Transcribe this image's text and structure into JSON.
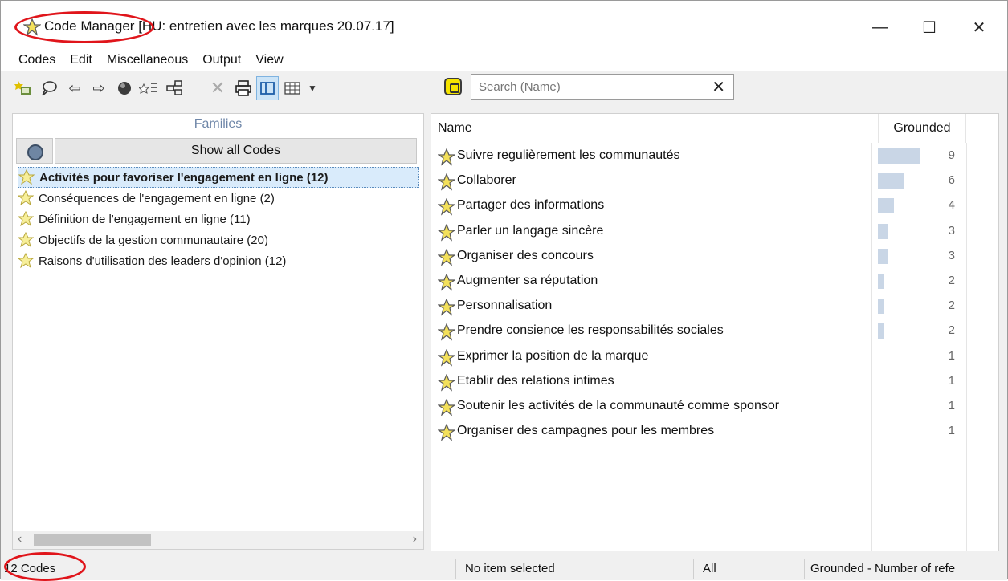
{
  "window": {
    "app_title": "Code Manager",
    "doc_title": "[HU: entretien avec les marques 20.07.17]",
    "minimize": "—",
    "maximize": "☐",
    "close": "✕"
  },
  "menu": [
    "Codes",
    "Edit",
    "Miscellaneous",
    "Output",
    "View"
  ],
  "search": {
    "placeholder": "Search (Name)",
    "clear": "✕"
  },
  "families": {
    "title": "Families",
    "show_all": "Show all Codes",
    "items": [
      {
        "label": "Activités pour favoriser l'engagement en ligne (12)",
        "selected": true
      },
      {
        "label": "Conséquences de l'engagement en ligne (2)",
        "selected": false
      },
      {
        "label": "Définition de l'engagement en ligne (11)",
        "selected": false
      },
      {
        "label": "Objectifs de la gestion communautaire (20)",
        "selected": false
      },
      {
        "label": "Raisons d'utilisation des leaders d'opinion (12)",
        "selected": false
      }
    ]
  },
  "codes": {
    "columns": {
      "name": "Name",
      "grounded": "Grounded"
    },
    "rows": [
      {
        "name": "Suivre regulièrement les communautés",
        "grounded": 9
      },
      {
        "name": "Collaborer",
        "grounded": 6
      },
      {
        "name": "Partager des informations",
        "grounded": 4
      },
      {
        "name": "Parler un langage sincère",
        "grounded": 3
      },
      {
        "name": "Organiser des concours",
        "grounded": 3
      },
      {
        "name": "Augmenter sa réputation",
        "grounded": 2
      },
      {
        "name": "Personnalisation",
        "grounded": 2
      },
      {
        "name": "Prendre consience les responsabilités sociales",
        "grounded": 2
      },
      {
        "name": "Exprimer la position de la marque",
        "grounded": 1
      },
      {
        "name": "Etablir des relations intimes",
        "grounded": 1
      },
      {
        "name": "Soutenir les activités de la communauté comme sponsor",
        "grounded": 1
      },
      {
        "name": "Organiser des campagnes pour les membres",
        "grounded": 1
      }
    ]
  },
  "status": {
    "count": "12 Codes",
    "selection": "No item selected",
    "filter": "All",
    "sort": "Grounded - Number of refe"
  },
  "colors": {
    "annotation_red": "#e0151b",
    "selection_blue": "#d9ebfb",
    "bar_fill": "#c9d6e6",
    "code_icon_yellow": "#f3e05a"
  }
}
